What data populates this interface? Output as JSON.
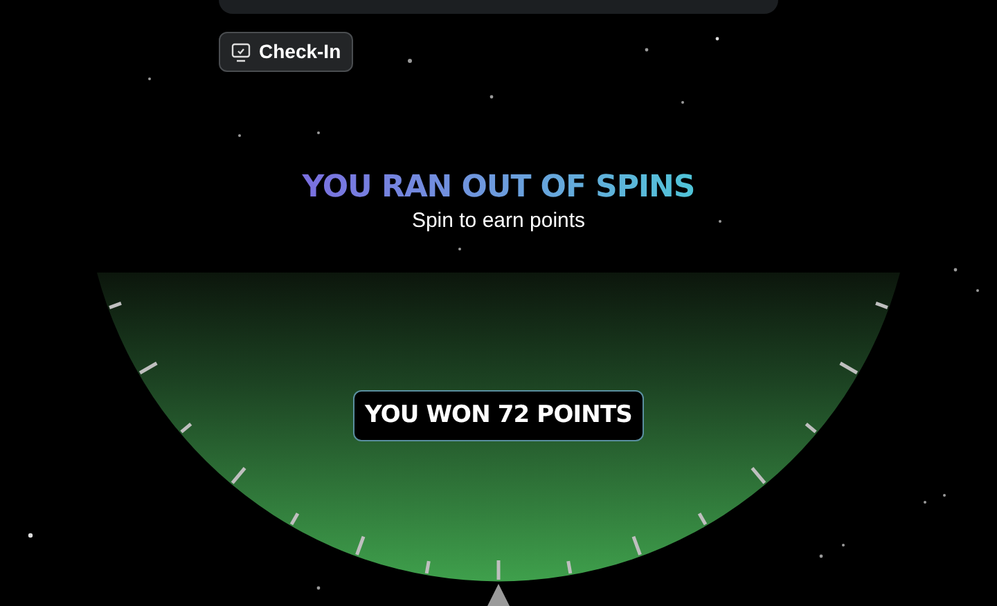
{
  "check_in_button": {
    "label": "Check-In"
  },
  "title": "YOU RAN OUT OF SPINS",
  "subtitle": "Spin to earn points",
  "result": "YOU WON 72 POINTS"
}
